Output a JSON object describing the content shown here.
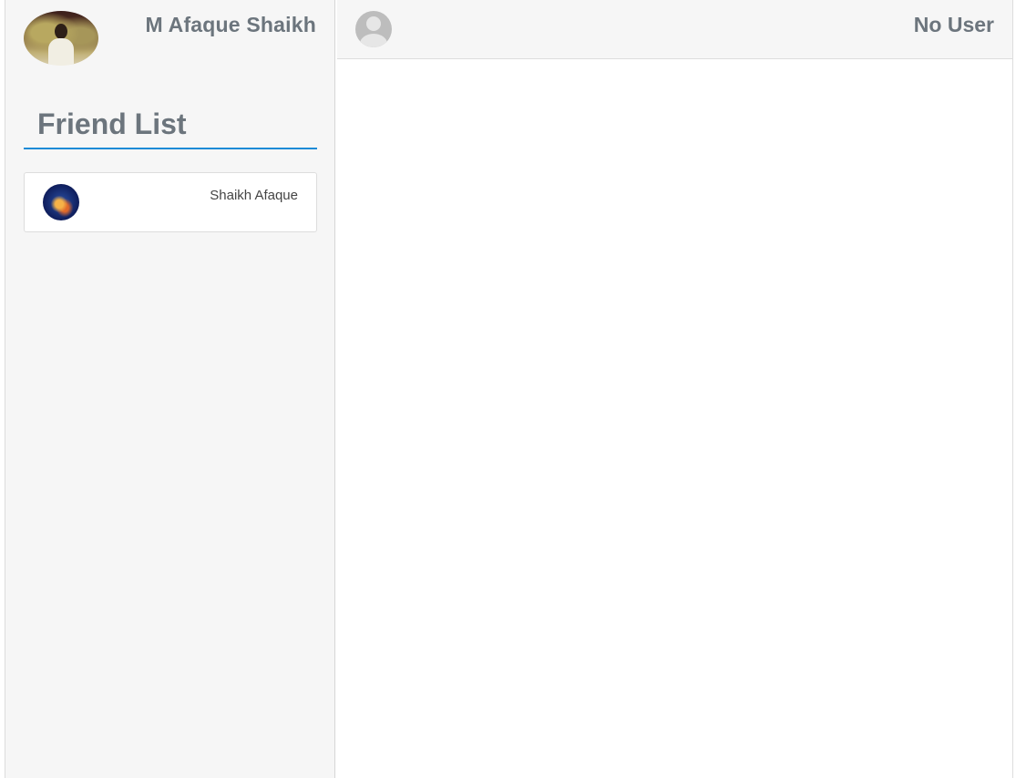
{
  "sidebar": {
    "profile": {
      "name": "M Afaque Shaikh",
      "avatar": "profile-photo"
    },
    "friend_list": {
      "title": "Friend List",
      "accent_color": "#1a8ad6",
      "items": [
        {
          "name": "Shaikh Afaque",
          "avatar": "jellyfish-photo"
        }
      ]
    }
  },
  "chat": {
    "header": {
      "username": "No User",
      "avatar": "default-user-icon"
    }
  }
}
